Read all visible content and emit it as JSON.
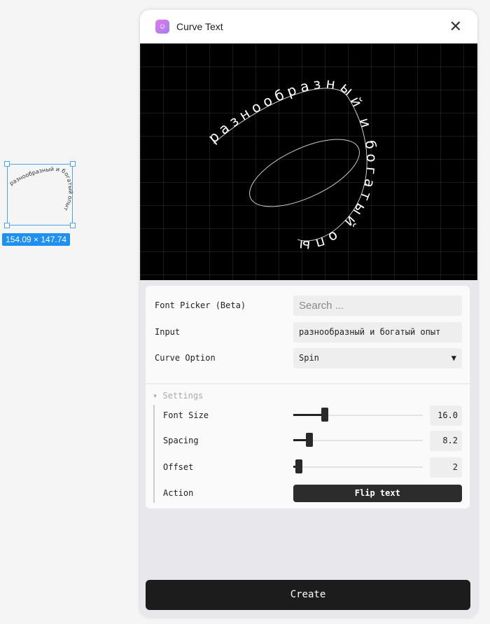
{
  "canvas": {
    "selection_size": "154.09 × 147.74",
    "preview_text": "разнообразный и богатый опыт"
  },
  "header": {
    "title": "Curve Text"
  },
  "form": {
    "font_picker_label": "Font Picker (Beta)",
    "font_picker_placeholder": "Search ...",
    "input_label": "Input",
    "input_value": "разнообразный и богатый опыт",
    "curve_label": "Curve Option",
    "curve_value": "Spin"
  },
  "settings": {
    "title": "Settings",
    "font_size": {
      "label": "Font Size",
      "value": "16.0",
      "fraction": 0.22
    },
    "spacing": {
      "label": "Spacing",
      "value": "8.2",
      "fraction": 0.1
    },
    "offset": {
      "label": "Offset",
      "value": "2",
      "fraction": 0.02
    },
    "action_label": "Action",
    "flip_label": "Flip text"
  },
  "create_label": "Create"
}
